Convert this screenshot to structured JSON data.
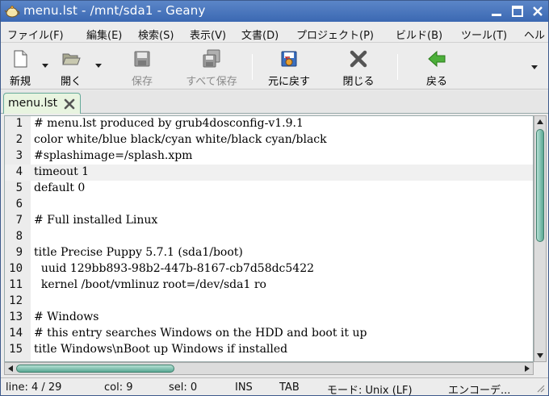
{
  "window": {
    "title": "menu.lst - /mnt/sda1 - Geany",
    "icon": "geany-teapot-icon",
    "accent": "#3b68b2"
  },
  "menubar": {
    "items": [
      "ファイル(F)",
      "編集(E)",
      "検索(S)",
      "表示(V)",
      "文書(D)",
      "プロジェクト(P)",
      "ビルド(B)",
      "ツール(T)",
      "ヘル"
    ]
  },
  "toolbar": {
    "new_label": "新規",
    "open_label": "開く",
    "save_label": "保存",
    "save_all_label": "すべて保存",
    "revert_label": "元に戻す",
    "close_label": "閉じる",
    "back_label": "戻る"
  },
  "tabs": [
    {
      "label": "menu.lst"
    }
  ],
  "editor": {
    "current_line": 4,
    "lines": [
      "# menu.lst produced by grub4dosconfig-v1.9.1",
      "color white/blue black/cyan white/black cyan/black",
      "#splashimage=/splash.xpm",
      "timeout 1",
      "default 0",
      "",
      "# Full installed Linux",
      "",
      "title Precise Puppy 5.7.1 (sda1/boot)",
      "  uuid 129bb893-98b2-447b-8167-cb7d58dc5422",
      "  kernel /boot/vmlinuz root=/dev/sda1 ro",
      "",
      "# Windows",
      "# this entry searches Windows on the HDD and boot it up",
      "title Windows\\nBoot up Windows if installed"
    ]
  },
  "statusbar": {
    "line": "line: 4 / 29",
    "col": "col: 9",
    "sel": "sel: 0",
    "ins": "INS",
    "tab": "TAB",
    "mode": "モード: Unix (LF)",
    "encoding": "エンコーデ..."
  }
}
